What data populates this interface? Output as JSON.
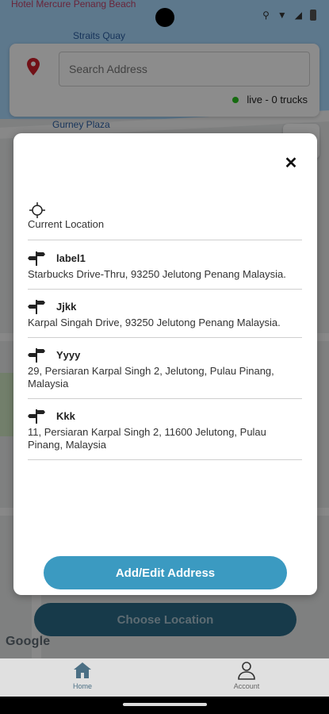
{
  "map": {
    "labels": [
      "Hotel Mercure Penang Beach",
      "Straits Quay",
      "Gurney Plaza"
    ]
  },
  "search": {
    "placeholder": "Search Address",
    "live_status": "live - 0 trucks"
  },
  "modal": {
    "current_location_label": "Current Location",
    "addresses": [
      {
        "name": "label1",
        "address": "Starbucks Drive-Thru, 93250 Jelutong Penang Malaysia."
      },
      {
        "name": "Jjkk",
        "address": "Karpal Singah Drive, 93250 Jelutong Penang Malaysia."
      },
      {
        "name": "Yyyy",
        "address": "29, Persiaran Karpal Singh 2, Jelutong, Pulau Pinang, Malaysia"
      },
      {
        "name": "Kkk",
        "address": "11, Persiaran Karpal Singh 2, 11600 Jelutong, Pulau Pinang, Malaysia"
      }
    ],
    "add_edit_label": "Add/Edit Address"
  },
  "choose_location_label": "Choose Location",
  "google_logo": "Google",
  "nav": {
    "home_label": "Home",
    "account_label": "Account"
  },
  "colors": {
    "primary": "#3b9ac1",
    "live_dot": "#29c41e",
    "pin": "#d0202a"
  }
}
